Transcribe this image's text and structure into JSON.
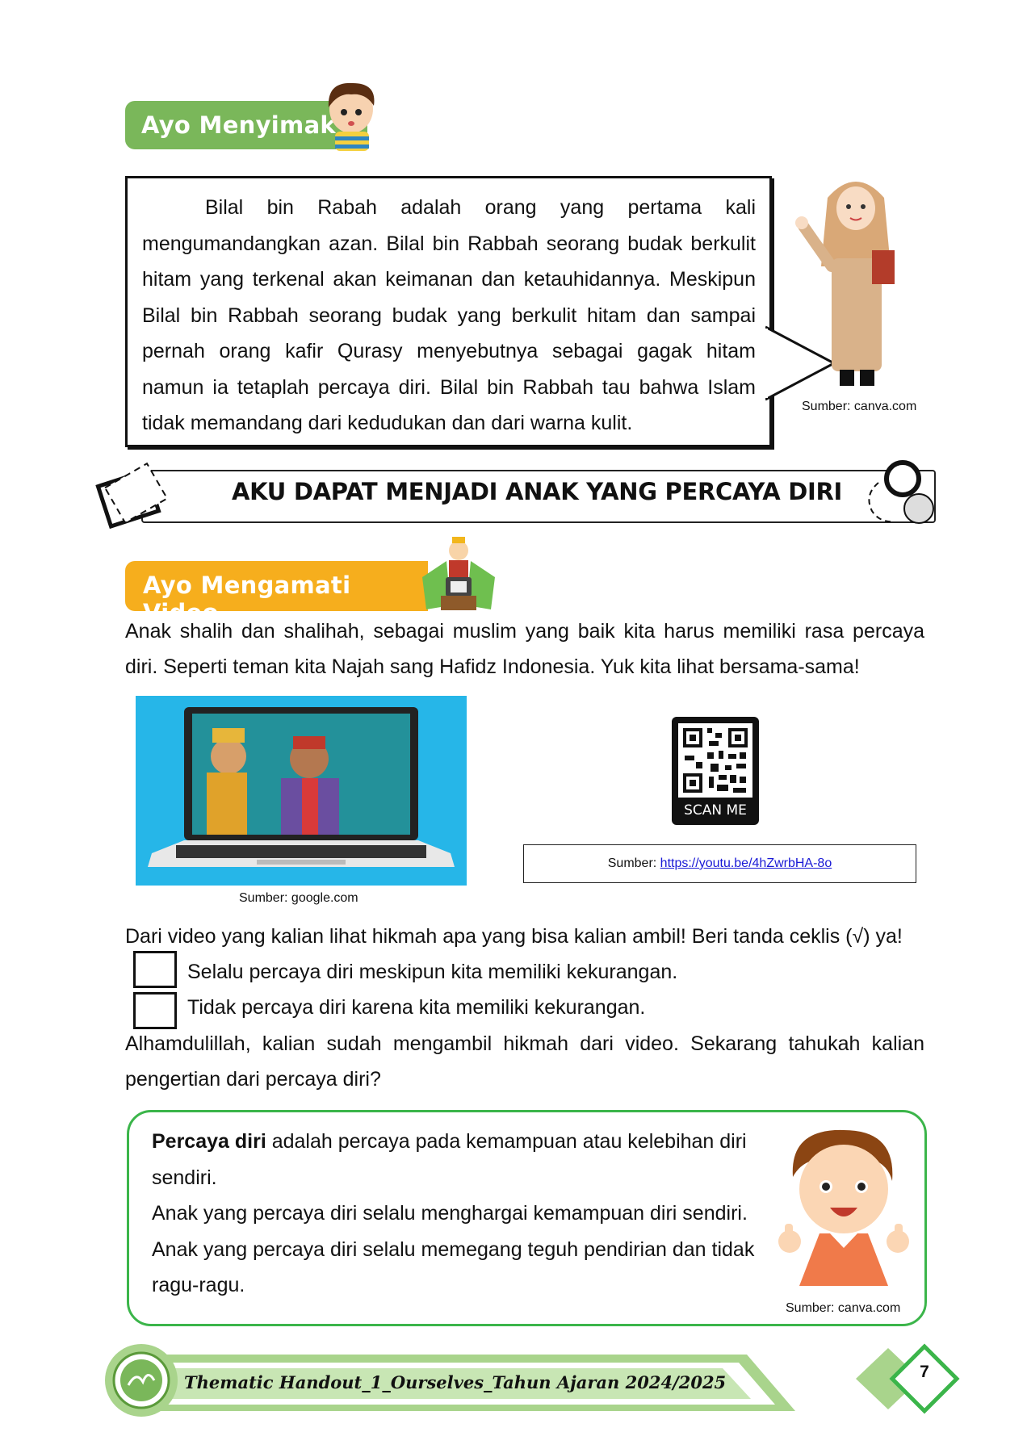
{
  "section1": {
    "label": "Ayo Menyimak"
  },
  "story": {
    "text": "Bilal bin Rabah adalah orang yang pertama kali mengumandangkan azan. Bilal bin Rabbah seorang budak berkulit hitam yang terkenal akan keimanan dan ketauhidannya. Meskipun Bilal bin Rabbah seorang budak yang berkulit hitam dan sampai pernah orang kafir Qurasy menyebutnya sebagai gagak hitam namun ia tetaplah percaya diri. Bilal bin Rabbah tau bahwa Islam tidak memandang dari kedudukan dan dari warna kulit.",
    "source": "Sumber: canva.com"
  },
  "title": "AKU DAPAT MENJADI ANAK YANG PERCAYA DIRI",
  "section2": {
    "label": "Ayo Mengamati Video"
  },
  "intro": "Anak shalih dan shalihah, sebagai muslim yang baik kita harus memiliki rasa percaya diri. Seperti teman kita Najah sang Hafidz Indonesia. Yuk kita lihat bersama-sama!",
  "video": {
    "image_source": "Sumber: google.com",
    "qr_label": "SCAN ME",
    "source_prefix": "Sumber: ",
    "source_link": "https://youtu.be/4hZwrbHA-8o"
  },
  "question": "Dari video yang kalian lihat hikmah apa yang bisa kalian ambil! Beri tanda ceklis (√) ya!",
  "options": [
    {
      "label": "Selalu percaya diri meskipun kita memiliki kekurangan."
    },
    {
      "label": "Tidak percaya diri karena kita memiliki kekurangan."
    }
  ],
  "closing": "Alhamdulillah, kalian sudah mengambil hikmah dari video. Sekarang tahukah kalian pengertian dari percaya diri?",
  "definition": {
    "term": "Percaya diri",
    "rest": " adalah percaya pada kemampuan atau kelebihan diri sendiri.",
    "line2": "Anak yang percaya diri selalu menghargai kemampuan diri sendiri.",
    "line3": "Anak yang percaya diri selalu memegang teguh pendirian dan tidak ragu-ragu.",
    "source": "Sumber: canva.com"
  },
  "footer": {
    "text": "Thematic Handout_1_Ourselves_Tahun Ajaran 2024/2025",
    "page": "7"
  },
  "colors": {
    "green": "#7ab75a",
    "orange": "#f6ae1d",
    "box_green": "#3bb54a",
    "link": "#1a1ad6"
  }
}
